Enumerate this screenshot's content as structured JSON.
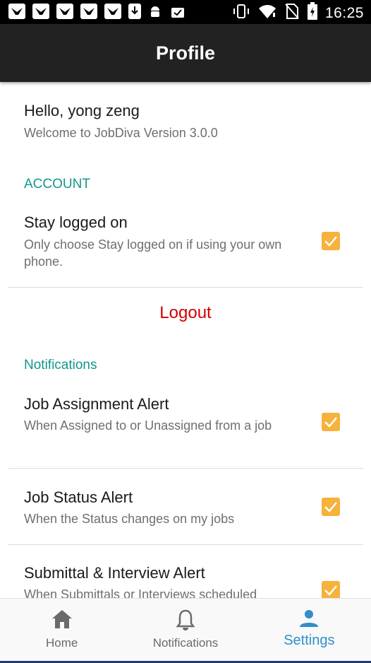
{
  "status_bar": {
    "time": "16:25",
    "notification_icons": [
      "bird-icon",
      "bird-icon",
      "bird-icon",
      "bird-icon",
      "bird-icon",
      "download-icon",
      "android-icon",
      "clipboard-check-icon"
    ],
    "system_icons": [
      "vibrate-icon",
      "wifi-icon",
      "no-sim-icon",
      "battery-charging-icon"
    ]
  },
  "app_bar": {
    "title": "Profile"
  },
  "greeting": {
    "hello": "Hello, yong zeng",
    "welcome": "Welcome to JobDiva Version 3.0.0"
  },
  "account": {
    "header": "ACCOUNT",
    "stay_logged_on": {
      "title": "Stay logged on",
      "subtitle": "Only choose Stay logged on if using your own phone.",
      "checked": true
    },
    "logout_label": "Logout"
  },
  "notifications": {
    "header": "Notifications",
    "items": [
      {
        "title": "Job Assignment Alert",
        "subtitle": "When Assigned to or Unassigned from a job",
        "checked": true
      },
      {
        "title": "Job Status Alert",
        "subtitle": "When the Status changes on my jobs",
        "checked": true
      },
      {
        "title": "Submittal & Interview Alert",
        "subtitle": "When Submittals or Interviews scheduled",
        "checked": true
      }
    ]
  },
  "bottom_nav": {
    "items": [
      {
        "label": "Home",
        "icon": "home-icon",
        "active": false
      },
      {
        "label": "Notifications",
        "icon": "bell-icon",
        "active": false
      },
      {
        "label": "Settings",
        "icon": "person-icon",
        "active": true
      }
    ]
  },
  "colors": {
    "accent": "#12978a",
    "checkbox": "#f6b23a",
    "logout": "#d40000",
    "active_tab": "#2f8fc9",
    "app_bar": "#222222"
  }
}
